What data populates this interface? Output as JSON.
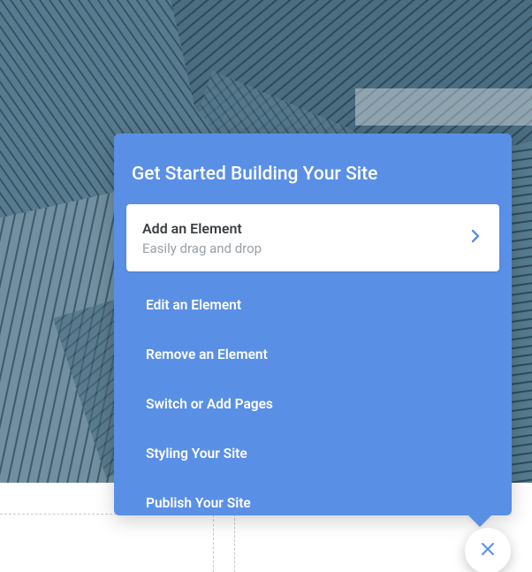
{
  "colors": {
    "accent": "#5a8fe6",
    "hero": "#415f72"
  },
  "popover": {
    "title": "Get Started Building Your Site",
    "selected": {
      "title": "Add an Element",
      "subtitle": "Easily drag and drop"
    },
    "items": [
      {
        "label": "Edit an Element"
      },
      {
        "label": "Remove an Element"
      },
      {
        "label": "Switch or Add Pages"
      },
      {
        "label": "Styling Your Site"
      },
      {
        "label": "Publish Your Site"
      }
    ]
  }
}
